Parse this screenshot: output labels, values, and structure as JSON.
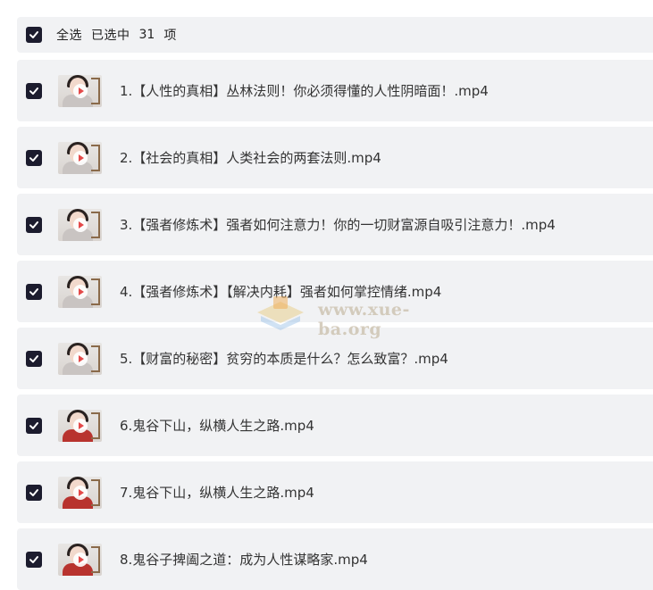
{
  "header": {
    "select_all": "全选",
    "selected_prefix": "已选中",
    "selected_count": "31",
    "selected_unit": "项"
  },
  "items": [
    {
      "title": "1.【人性的真相】丛林法则！你必须得懂的人性阴暗面！.mp4",
      "thumb": "white"
    },
    {
      "title": "2.【社会的真相】人类社会的两套法则.mp4",
      "thumb": "white"
    },
    {
      "title": "3.【强者修炼术】强者如何注意力！你的一切财富源自吸引注意力！.mp4",
      "thumb": "white"
    },
    {
      "title": "4.【强者修炼术】【解决内耗】强者如何掌控情绪.mp4",
      "thumb": "white"
    },
    {
      "title": "5.【财富的秘密】贫穷的本质是什么？怎么致富？.mp4",
      "thumb": "white"
    },
    {
      "title": "6.鬼谷下山，纵横人生之路.mp4",
      "thumb": "red"
    },
    {
      "title": "7.鬼谷下山，纵横人生之路.mp4",
      "thumb": "red"
    },
    {
      "title": "8.鬼谷子捭阖之道：成为人性谋略家.mp4",
      "thumb": "red"
    }
  ],
  "watermark": {
    "text": "www.xue-ba.org"
  },
  "colors": {
    "checkbox": "#1c1c2e",
    "row_bg": "#f1f2f4"
  }
}
